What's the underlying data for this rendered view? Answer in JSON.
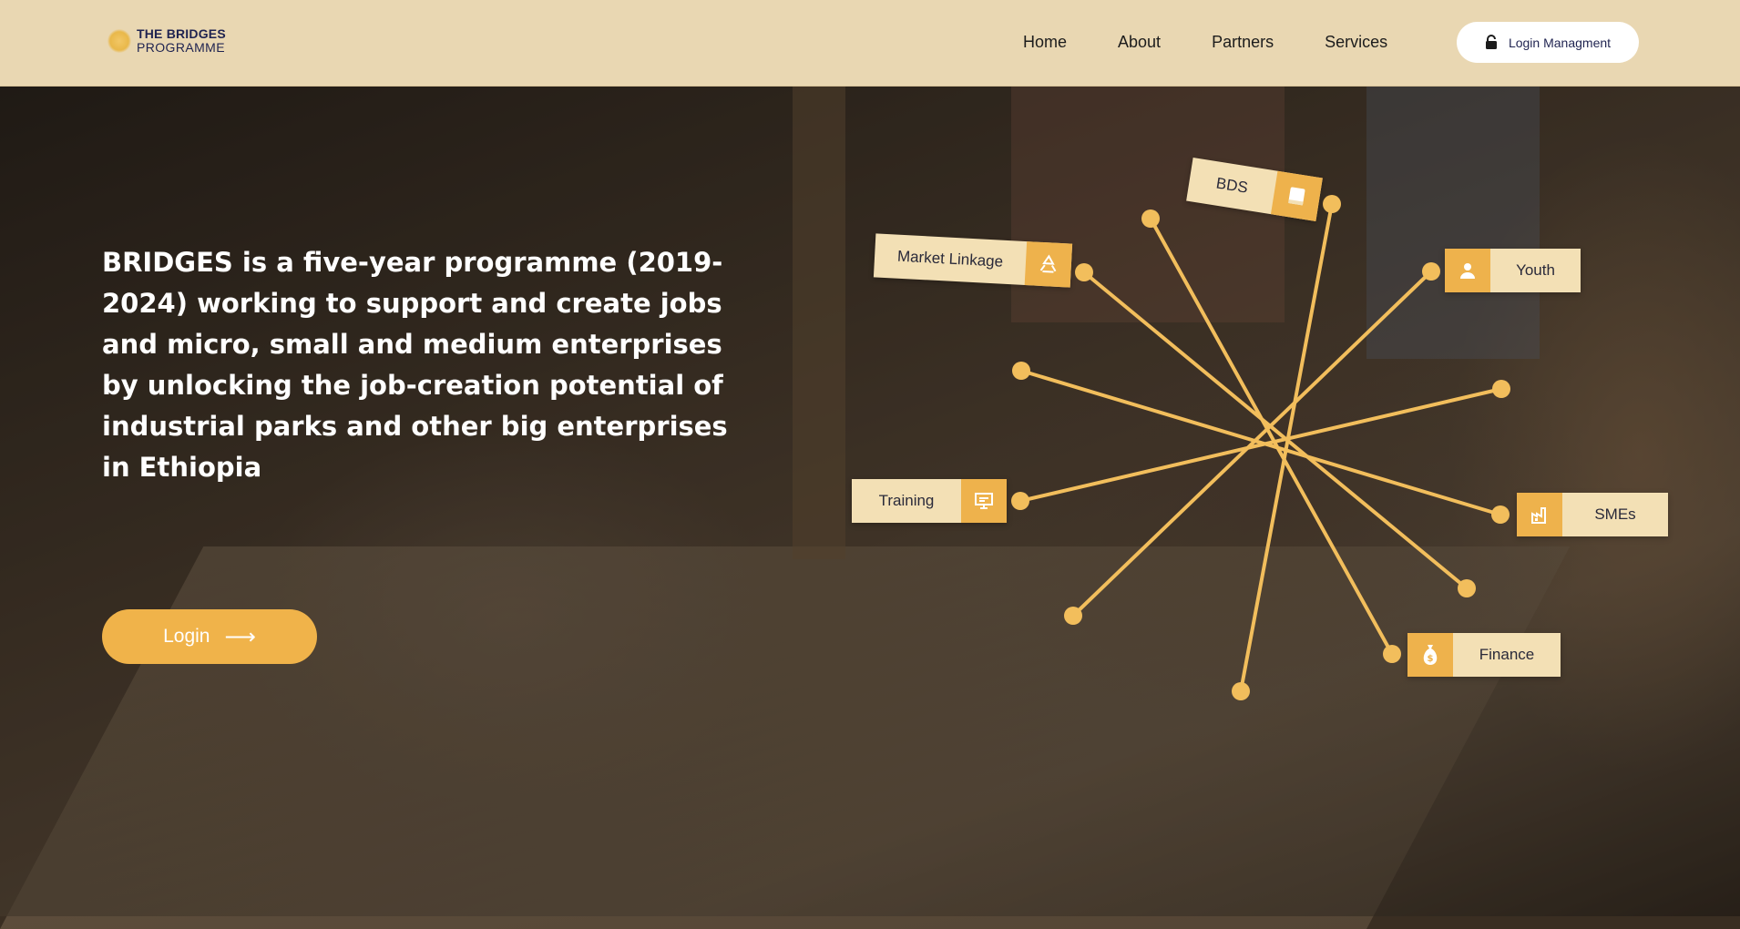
{
  "header": {
    "logo": {
      "line1": "THE BRIDGES",
      "line2": "PROGRAMME"
    },
    "nav": [
      {
        "label": "Home"
      },
      {
        "label": "About"
      },
      {
        "label": "Partners"
      },
      {
        "label": "Services"
      }
    ],
    "login_management_label": "Login Managment"
  },
  "hero": {
    "text": "BRIDGES is a five-year programme (2019-2024) working to support and create jobs and micro, small and medium enterprises by unlocking the job-creation potential of industrial parks and other big enterprises in Ethiopia",
    "login_label": "Login",
    "login_arrow": "⟶"
  },
  "network": {
    "accent": "#f0b84e",
    "tags": {
      "bds": {
        "label": "BDS",
        "icon": "book-icon"
      },
      "market_linkage": {
        "label": "Market Linkage",
        "icon": "recycle-icon"
      },
      "youth": {
        "label": "Youth",
        "icon": "user-icon"
      },
      "training": {
        "label": "Training",
        "icon": "presentation-icon"
      },
      "smes": {
        "label": "SMEs",
        "icon": "factory-icon"
      },
      "finance": {
        "label": "Finance",
        "icon": "money-bag-icon"
      }
    }
  }
}
